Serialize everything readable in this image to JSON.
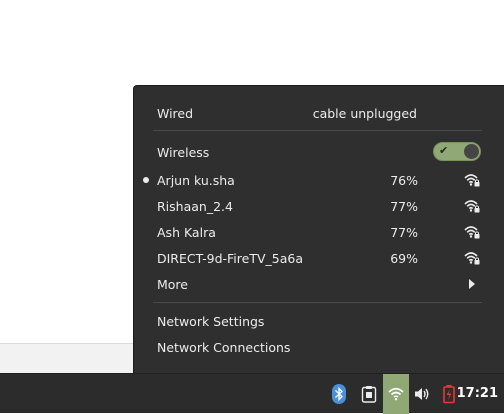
{
  "network_menu": {
    "wired": {
      "label": "Wired",
      "status": "cable unplugged"
    },
    "wireless": {
      "label": "Wireless",
      "enabled": true
    },
    "networks": [
      {
        "name": "Arjun ku.sha",
        "signal": "76%",
        "connected": true
      },
      {
        "name": "Rishaan_2.4",
        "signal": "77%",
        "connected": false
      },
      {
        "name": "Ash Kalra",
        "signal": "77%",
        "connected": false
      },
      {
        "name": "DIRECT-9d-FireTV_5a6a",
        "signal": "69%",
        "connected": false
      }
    ],
    "more_label": "More",
    "settings_label": "Network Settings",
    "connections_label": "Network Connections"
  },
  "panel": {
    "tray_icons": [
      "bluetooth-icon",
      "clipboard-icon",
      "wifi-icon",
      "volume-icon",
      "battery-icon"
    ],
    "clock": "17:21"
  },
  "colors": {
    "menu_bg": "#2f2f2f",
    "accent": "#8fa876",
    "panel_bg": "#2c2c2c",
    "bluetooth": "#4a90d9",
    "battery_alert": "#e53935"
  }
}
